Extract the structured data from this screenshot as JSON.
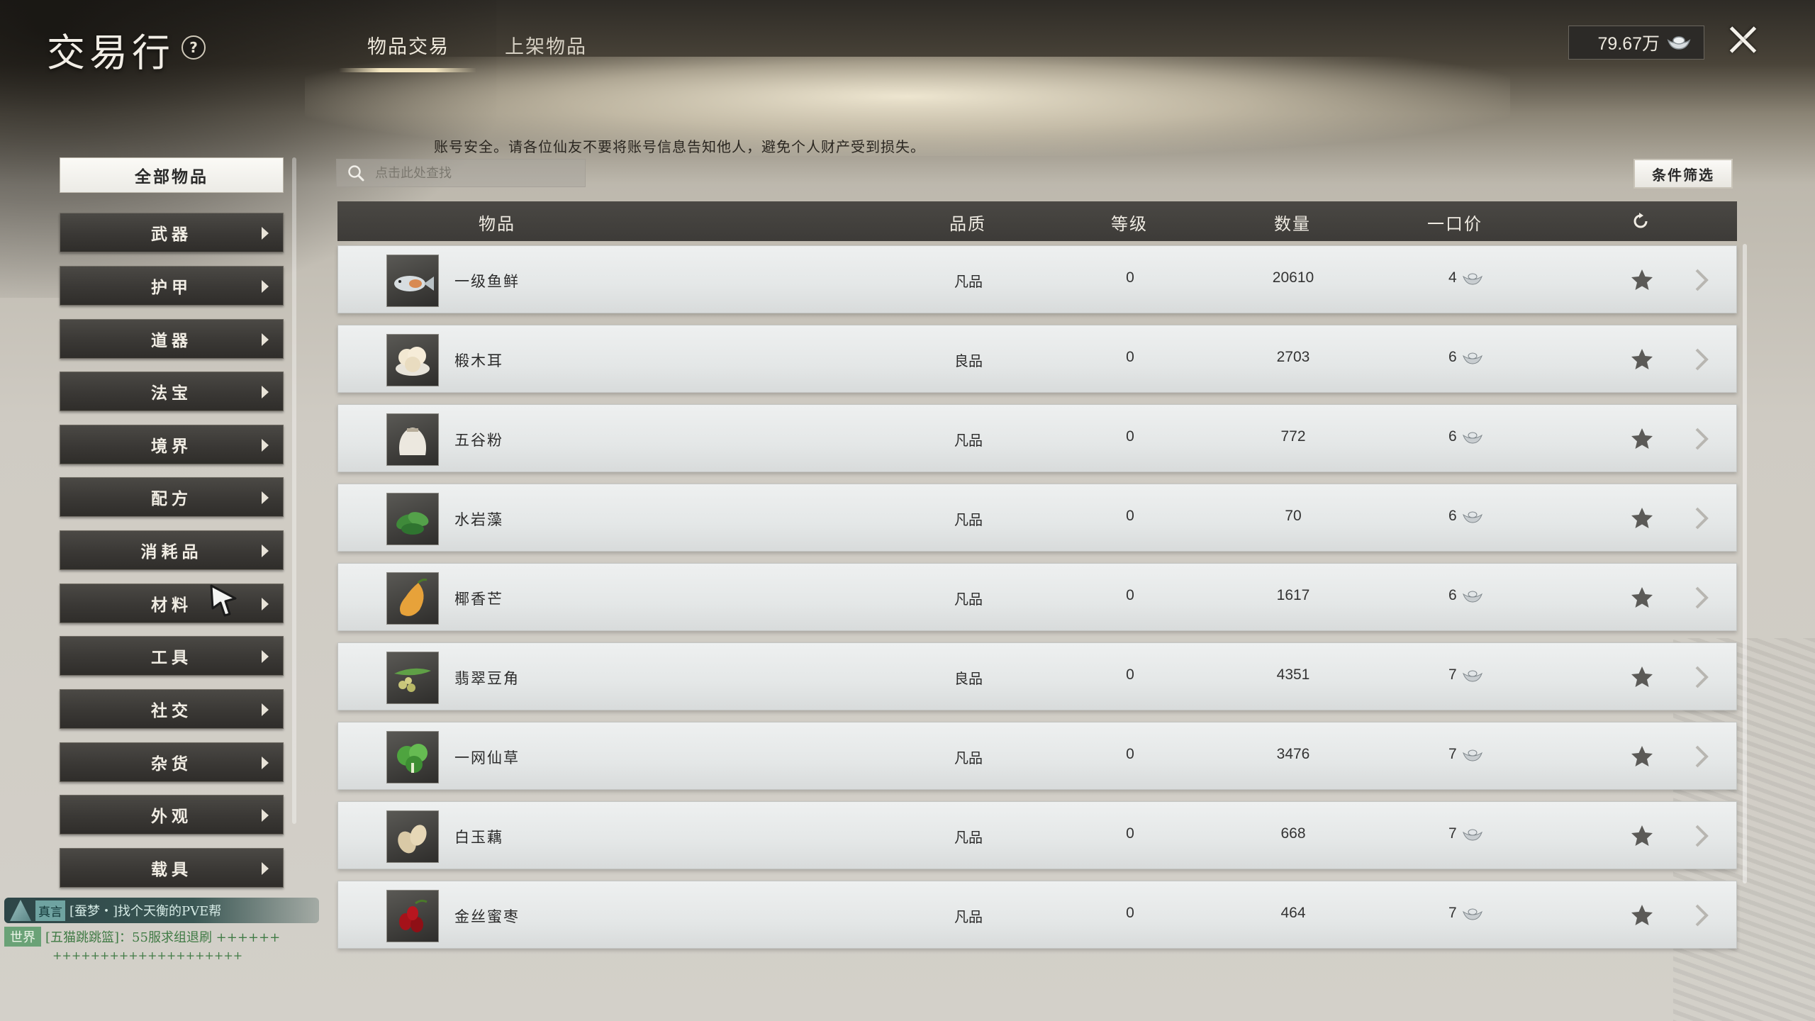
{
  "header": {
    "title": "交易行",
    "tabs": [
      "物品交易",
      "上架物品"
    ],
    "currency": "79.67万"
  },
  "notice": "账号安全。请各位仙友不要将账号信息告知他人，避免个人财产受到损失。",
  "sidebar": {
    "all_items": "全部物品",
    "categories": [
      "武器",
      "护甲",
      "道器",
      "法宝",
      "境界",
      "配方",
      "消耗品",
      "材料",
      "工具",
      "社交",
      "杂货",
      "外观",
      "载具"
    ]
  },
  "search": {
    "placeholder": "点击此处查找"
  },
  "filter_label": "条件筛选",
  "table": {
    "headers": [
      "物品",
      "品质",
      "等级",
      "数量",
      "一口价"
    ],
    "rows": [
      {
        "name": "一级鱼鲜",
        "quality": "凡品",
        "level": "0",
        "qty": "20610",
        "price": "4",
        "icon": "fish-icon"
      },
      {
        "name": "椴木耳",
        "quality": "良品",
        "level": "0",
        "qty": "2703",
        "price": "6",
        "icon": "fungus-icon"
      },
      {
        "name": "五谷粉",
        "quality": "凡品",
        "level": "0",
        "qty": "772",
        "price": "6",
        "icon": "flour-sack-icon"
      },
      {
        "name": "水岩藻",
        "quality": "凡品",
        "level": "0",
        "qty": "70",
        "price": "6",
        "icon": "seaweed-icon"
      },
      {
        "name": "椰香芒",
        "quality": "凡品",
        "level": "0",
        "qty": "1617",
        "price": "6",
        "icon": "mango-icon"
      },
      {
        "name": "翡翠豆角",
        "quality": "良品",
        "level": "0",
        "qty": "4351",
        "price": "7",
        "icon": "bean-pod-icon"
      },
      {
        "name": "一网仙草",
        "quality": "凡品",
        "level": "0",
        "qty": "3476",
        "price": "7",
        "icon": "herb-icon"
      },
      {
        "name": "白玉藕",
        "quality": "凡品",
        "level": "0",
        "qty": "668",
        "price": "7",
        "icon": "lotus-root-icon"
      },
      {
        "name": "金丝蜜枣",
        "quality": "凡品",
        "level": "0",
        "qty": "464",
        "price": "7",
        "icon": "jujube-icon"
      }
    ]
  },
  "chat": {
    "tag": "真言",
    "text": "[蚕梦・]找个天衡的PVE帮",
    "world_tag": "世界",
    "world_text": "[五猫跳跳篮]：55服求组退刷 ++++++",
    "world_text_cont": "++++++++++++++++++++"
  },
  "colors": {
    "header_bar": "#3d3b38",
    "category_button": "#3a3835",
    "row_background": "#e4e7e7",
    "chat_bar": "#3a5754",
    "world_tag": "#6aa277"
  }
}
